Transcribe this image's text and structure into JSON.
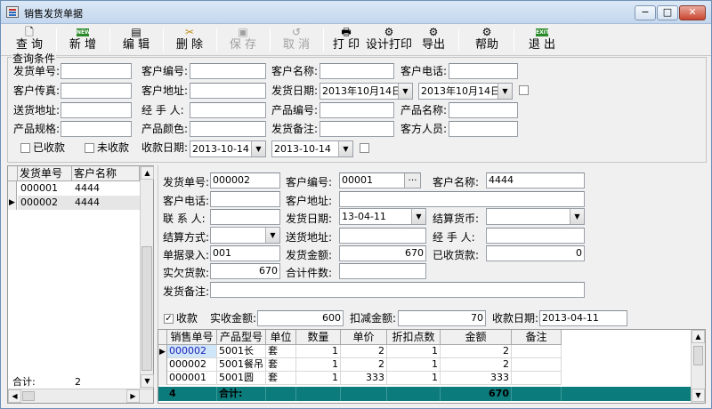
{
  "window": {
    "title": "销售发货单据",
    "controls": {
      "minimize": "−",
      "maximize": "□",
      "close": "✕"
    }
  },
  "toolbar": {
    "query": "查 询",
    "add": "新 增",
    "edit": "编 辑",
    "delete": "删 除",
    "save": "保 存",
    "cancel": "取 消",
    "print": "打 印",
    "design_print": "设计打印",
    "export": "导出",
    "help": "帮助",
    "exit": "退 出",
    "new_badge": "NEW",
    "exit_badge": "EXIT"
  },
  "query": {
    "group_title": "查询条件",
    "ship_no_label": "发货单号:",
    "cust_code_label": "客户编号:",
    "cust_name_label": "客户名称:",
    "cust_phone_label": "客户电话:",
    "cust_fax_label": "客户传真:",
    "cust_addr_label": "客户地址:",
    "ship_date_label": "发货日期:",
    "ship_date_from": "2013年10月14日",
    "ship_date_to": "2013年10月14日",
    "ship_addr_label": "送货地址:",
    "handler_label": "经 手 人:",
    "product_code_label": "产品编号:",
    "product_name_label": "产品名称:",
    "product_spec_label": "产品规格:",
    "product_color_label": "产品颜色:",
    "ship_note_label": "发货备注:",
    "cust_staff_label": "客方人员:",
    "received_label": "已收款",
    "unreceived_label": "未收款",
    "receipt_date_label": "收款日期:",
    "receipt_date_from": "2013-10-14",
    "receipt_date_to": "2013-10-14"
  },
  "list": {
    "headers": [
      "发货单号",
      "客户名称"
    ],
    "rows": [
      {
        "no": "000001",
        "name": "4444"
      },
      {
        "no": "000002",
        "name": "4444"
      }
    ],
    "total_label": "合计:",
    "total_value": "2"
  },
  "detail": {
    "ship_no_label": "发货单号:",
    "ship_no": "000002",
    "cust_code_label": "客户编号:",
    "cust_code": "00001",
    "cust_name_label": "客户名称:",
    "cust_name": "4444",
    "cust_phone_label": "客户电话:",
    "cust_addr_label": "客户地址:",
    "contact_label": "联 系 人:",
    "ship_date_label": "发货日期:",
    "ship_date": "13-04-11",
    "currency_label": "结算货币:",
    "settle_label": "结算方式:",
    "delivery_addr_label": "送货地址:",
    "handler_label": "经 手 人:",
    "entry_label": "单据录入:",
    "entry": "001",
    "amount_label": "发货金额:",
    "amount": "670",
    "received_label": "已收货款:",
    "received": "0",
    "owed_label": "实欠货款:",
    "owed": "670",
    "count_label": "合计件数:",
    "note_label": "发货备注:",
    "pay_check_label": "收款",
    "actual_label": "实收金额:",
    "actual": "600",
    "deduct_label": "扣减金额:",
    "deduct": "70",
    "receipt_date_label": "收款日期:",
    "receipt_date": "2013-04-11"
  },
  "grid": {
    "headers": [
      "销售单号",
      "产品型号",
      "单位",
      "数量",
      "单价",
      "折扣点数",
      "金额",
      "备注"
    ],
    "rows": [
      [
        "000002",
        "5001长",
        "套",
        "1",
        "2",
        "1",
        "2",
        ""
      ],
      [
        "000002",
        "5001餐吊",
        "套",
        "1",
        "2",
        "1",
        "2",
        ""
      ],
      [
        "000001",
        "5001圆",
        "套",
        "1",
        "333",
        "1",
        "333",
        ""
      ]
    ],
    "total_count": "4",
    "total_label": "合计:",
    "total_amount": "670"
  },
  "colors": {
    "total_row": "#0b7b7b",
    "selected_row": "#cfe6f8",
    "titlebar": "#c4d7ee"
  }
}
